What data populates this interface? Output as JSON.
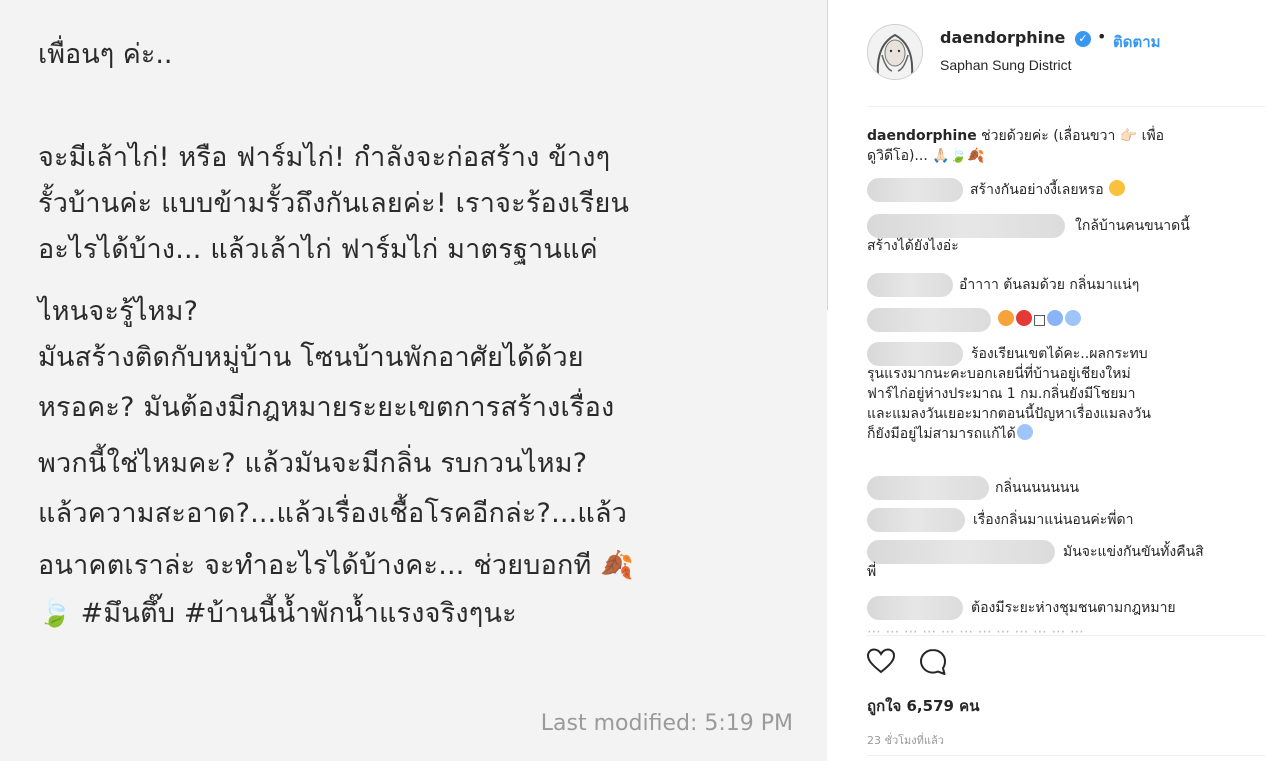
{
  "note": {
    "title": "เพื่อนๆ ค่ะ..",
    "lines": [
      "  จะมีเล้าไก่! หรือ ฟาร์มไก่! กำลังจะก่อสร้าง ข้างๆ",
      "รั้วบ้านค่ะ แบบข้ามรั้วถึงกันเลยค่ะ! เราจะร้องเรียน",
      "อะไรได้บ้าง... แล้วเล้าไก่ ฟาร์มไก่ มาตรฐานแค่",
      "ไหนจะรู้ไหม?",
      "  มันสร้างติดกับหมู่บ้าน โซนบ้านพักอาศัยได้ด้วย",
      "หรอคะ? มันต้องมีกฎหมายระยะเขตการสร้างเรื่อง",
      "พวกนี้ใช่ไหมคะ? แล้วมันจะมีกลิ่น รบกวนไหม?",
      "แล้วความสะอาด?...แล้วเรื่องเชื้อโรคอีกล่ะ?...แล้ว",
      "อนาคตเราล่ะ จะทำอะไรได้บ้างคะ... ช่วยบอกที 🍂",
      "🍃 #มึนตึ๊บ #บ้านนี้น้ำพักน้ำแรงจริงๆนะ"
    ],
    "modified": "Last modified: 5:19 PM"
  },
  "post": {
    "username": "daendorphine",
    "verified_icon": "verified-badge-icon",
    "dot": "•",
    "follow_label": "ติดตาม",
    "location": "Saphan Sung District",
    "caption_user": "daendorphine",
    "caption_text_1": " ช่วยด้วยค่ะ (เลื่อนขวา 👉🏻 เพื่อ",
    "caption_text_2": "ดูวิดีโอ)... 🙏🏻🍃🍂",
    "comments": [
      "สร้างกันอย่างงี้เลยหรอ",
      "ใกล้บ้านคนขนาดนี้",
      "สร้างได้ยังไงอ่ะ",
      "อำาาา ต้นลมด้วย กลิ่นมาแน่ๆ",
      "□",
      "ร้องเรียนเขตได้คะ..ผลกระทบ",
      "รุนแรงมากนะคะบอกเลยนี่ที่บ้านอยู่เชียงใหม่",
      "ฟาร์ไก่อยู่ห่างประมาณ 1 กม.กลิ่นยังมีโชยมา",
      "และแมลงวันเยอะมากตอนนี้ปัญหาเรื่องแมลงวัน",
      "ก็ยังมีอยู่ไม่สามารถแก้ได้",
      "กลิ่นนนนนนน",
      "เรื่องกลิ่นมาแน่นอนค่ะพี่ดา",
      "มันจะแข่งกันขันทั้งคืนสิ",
      "พี่",
      "ต้องมีระยะห่างชุมชนตามกฎหมาย"
    ],
    "likes": "ถูกใจ 6,579 คน",
    "time": "23 ชั่วโมงที่แล้ว",
    "icons": {
      "like": "heart-icon",
      "comment": "comment-icon"
    },
    "colors": {
      "link": "#3897f0",
      "text": "#262626",
      "muted": "#999999"
    }
  }
}
